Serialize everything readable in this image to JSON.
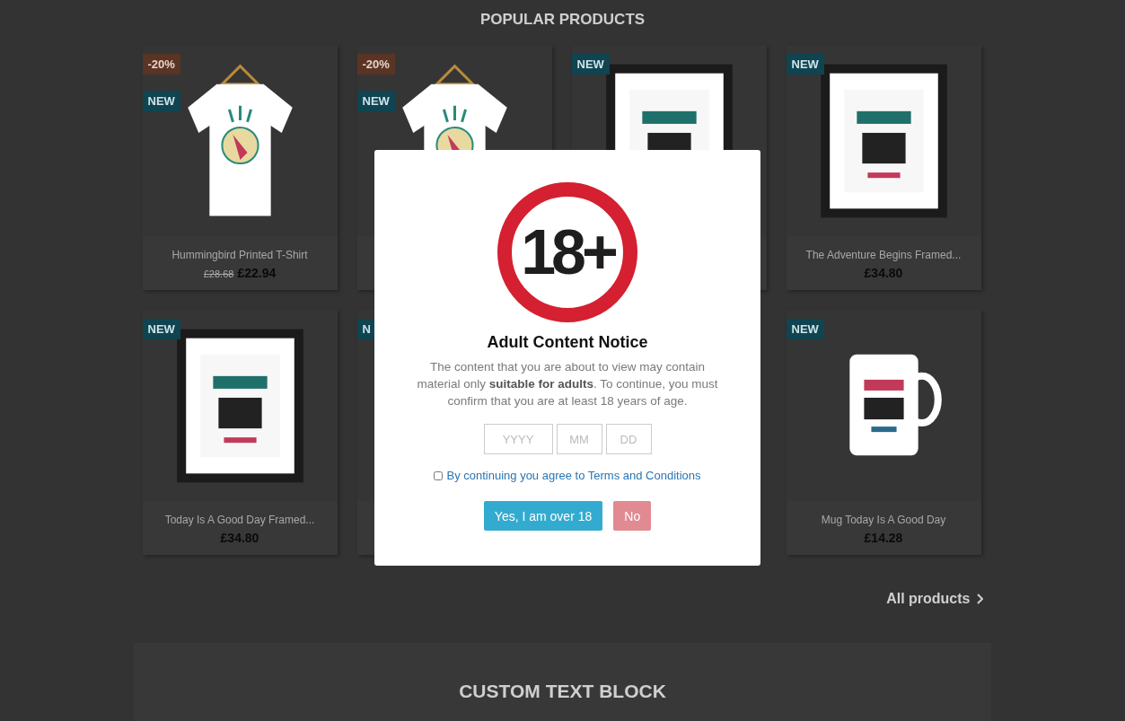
{
  "section_title": "POPULAR PRODUCTS",
  "products": [
    {
      "badges": [
        {
          "kind": "discount",
          "label": "-20%"
        },
        {
          "kind": "new",
          "label": "NEW"
        }
      ],
      "name": "Hummingbird Printed T-Shirt",
      "old_price": "£28.68",
      "price": "£22.94"
    },
    {
      "badges": [
        {
          "kind": "discount",
          "label": "-20%"
        },
        {
          "kind": "new",
          "label": "NEW"
        }
      ]
    },
    {
      "badges": [
        {
          "kind": "new",
          "label": "NEW"
        }
      ]
    },
    {
      "badges": [
        {
          "kind": "new",
          "label": "NEW"
        }
      ],
      "name": "The Adventure Begins Framed...",
      "price": "£34.80"
    },
    {
      "badges": [
        {
          "kind": "new",
          "label": "NEW"
        }
      ],
      "name": "Today Is A Good Day Framed...",
      "price": "£34.80"
    },
    {
      "badges": [
        {
          "kind": "new",
          "label": "N"
        }
      ]
    },
    {
      "badges": [
        {
          "kind": "new",
          "label": "NEW"
        }
      ],
      "name": "Mug Today Is A Good Day",
      "price": "£14.28"
    }
  ],
  "all_products_link": "All products",
  "custom_block": {
    "title": "CUSTOM TEXT BLOCK"
  },
  "modal": {
    "sign_text": "18+",
    "title": "Adult Content Notice",
    "message": "The content that you are about to view may contain material only **suitable for adults**. To continue, you must confirm that you are at least 18 years of age.",
    "date_fields": [
      {
        "placeholder": "YYYY"
      },
      {
        "placeholder": "MM"
      },
      {
        "placeholder": "DD"
      }
    ],
    "agree": {
      "label": "By continuing you agree to Terms and Conditions",
      "checked": false
    },
    "buttons": [
      {
        "kind": "confirm",
        "label": "Yes, I am over 18"
      },
      {
        "kind": "decline",
        "label": "No"
      }
    ]
  }
}
